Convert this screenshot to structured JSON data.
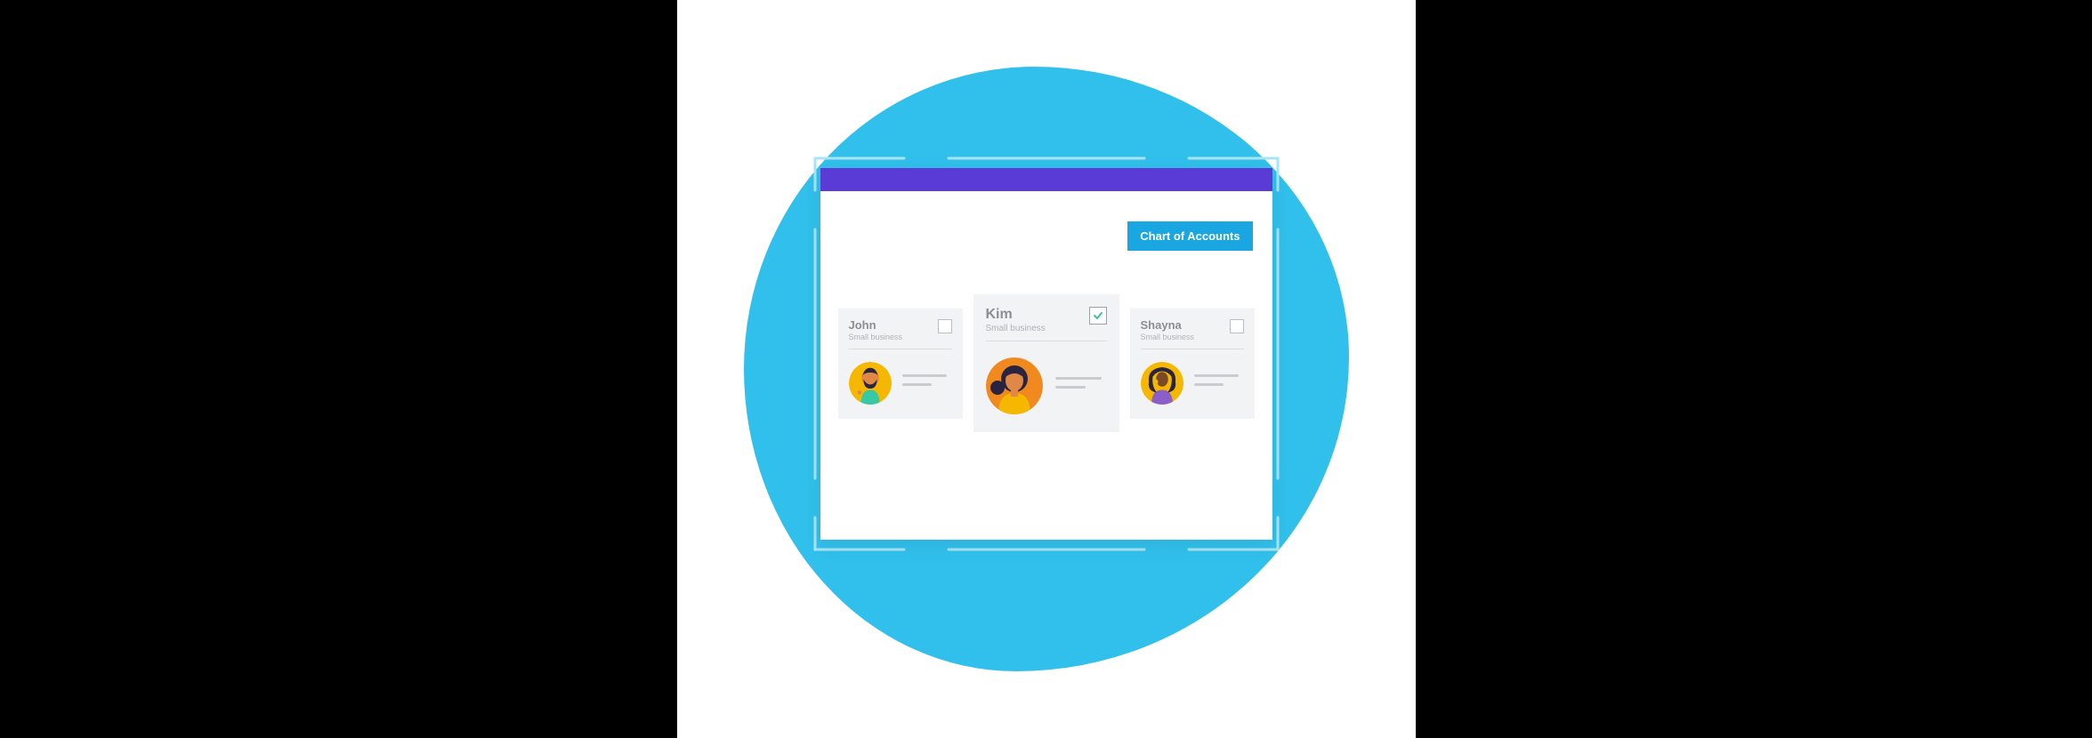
{
  "colors": {
    "blob": "#33bfe9",
    "header": "#5a3bd6",
    "button": "#1aa6e0",
    "checkmark": "#3fbf9b"
  },
  "toolbar": {
    "chart_of_accounts_label": "Chart of Accounts"
  },
  "cards": [
    {
      "name": "John",
      "subtitle": "Small business",
      "checked": false,
      "avatar_icon": "avatar-male-beard"
    },
    {
      "name": "Kim",
      "subtitle": "Small business",
      "checked": true,
      "avatar_icon": "avatar-female-bun",
      "featured": true
    },
    {
      "name": "Shayna",
      "subtitle": "Small business",
      "checked": false,
      "avatar_icon": "avatar-female-curly"
    }
  ]
}
